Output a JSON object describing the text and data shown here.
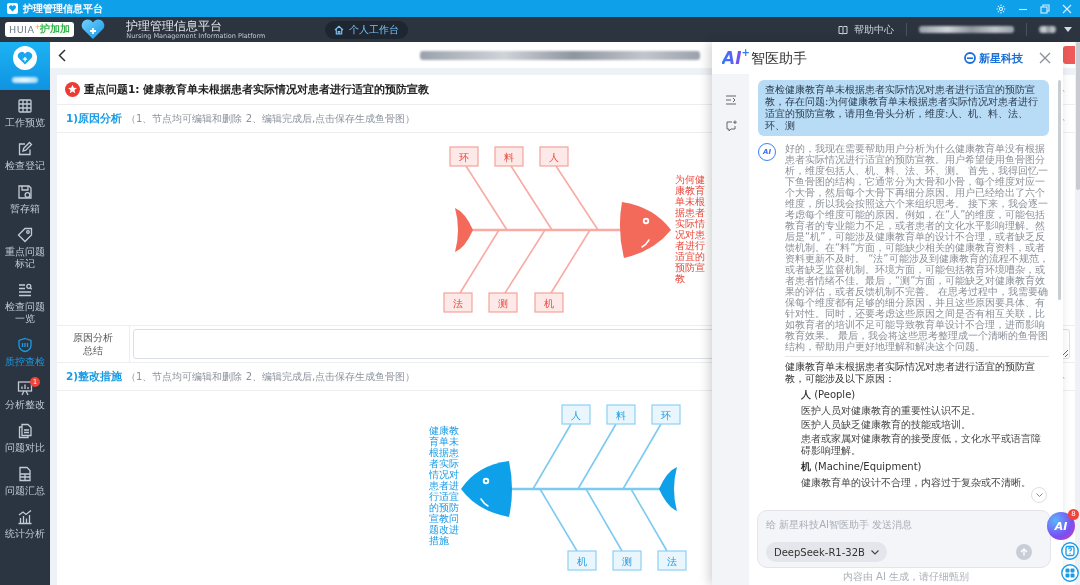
{
  "title_bar": {
    "title": "护理管理信息平台"
  },
  "header": {
    "logo": {
      "brand": "HUIA",
      "sup": "+",
      "name": "护加加"
    },
    "title": "护理管理信息平台",
    "subtitle": "Nursing Management Information Platform",
    "workspace_button": "个人工作台",
    "help": "帮助中心"
  },
  "sidebar": {
    "items": [
      {
        "label": "工作预览",
        "selected": false
      },
      {
        "label": "检查登记",
        "selected": false
      },
      {
        "label": "暂存箱",
        "selected": false
      },
      {
        "label": "重点问题标记",
        "selected": false
      },
      {
        "label": "检查问题一览",
        "selected": false
      },
      {
        "label": "质控查检",
        "selected": true
      },
      {
        "label": "分析整改",
        "selected": false,
        "badge": "1"
      },
      {
        "label": "问题对比",
        "selected": false
      },
      {
        "label": "问题汇总",
        "selected": false
      },
      {
        "label": "统计分析",
        "selected": false
      }
    ]
  },
  "problem": {
    "title": "重点问题1: 健康教育单未根据患者实际情况对患者进行适宜的预防宣教"
  },
  "sections": [
    {
      "kind": "cause",
      "title": "1)原因分析",
      "hint": "（1、节点均可编辑和删除 2、编辑完成后,点击保存生成鱼骨图）",
      "fishbone": {
        "effect": "为何健康教育单未根据患者实际情况对患者进行适宜的预防宣教",
        "top": [
          "环",
          "料",
          "人"
        ],
        "bottom": [
          "法",
          "测",
          "机"
        ]
      },
      "summary_label": "原因分析总结"
    },
    {
      "kind": "measure",
      "title": "2)整改措施",
      "hint": "（1、节点均可编辑和删除 2、编辑完成后,点击保存生成鱼骨图）",
      "fishbone": {
        "effect": "健康教育单未根据患者实际情况对患者进行适宜的预防宣教问题改进措施",
        "top": [
          "人",
          "料",
          "环"
        ],
        "bottom": [
          "机",
          "测",
          "法"
        ]
      }
    }
  ],
  "assistant": {
    "brand": {
      "mark": "AI",
      "sup": "+",
      "name": "智医助手"
    },
    "partner": "新星科技",
    "messages": [
      {
        "kind": "user",
        "text": "查检健康教育单未根据患者实际情况对患者进行适宜的预防宣教，存在问题:为何健康教育单未根据患者实际情况对患者进行适宜的预防宣教，请用鱼骨头分析，维度:人、机、料、法、环、测"
      },
      {
        "kind": "bot",
        "avatar": "AI",
        "thinking": "好的，我现在需要帮助用户分析为什么健康教育单没有根据患者实际情况进行适宜的预防宣教。用户希望使用鱼骨图分析，维度包括人、机、料、法、环、测。 首先，我得回忆一下鱼骨图的结构，它通常分为大骨和小骨，每个维度对应一个大骨，然后每个大骨下再细分原因。用户已经给出了六个维度，所以我会按照这六个来组织思考。 接下来，我会逐一考虑每个维度可能的原因。例如，在“人”的维度，可能包括教育者的专业能力不足，或者患者的文化水平影响理解。然后是“机”，可能涉及健康教育单的设计不合理，或者缺乏反馈机制。在“料”方面，可能缺少相关的健康教育资料，或者资料更新不及时。 “法”可能涉及到健康教育的流程不规范，或者缺乏监督机制。环境方面，可能包括教育环境嘈杂，或者患者情绪不佳。最后，“测”方面，可能缺乏对健康教育效果的评估，或者反馈机制不完善。 在思考过程中，我需要确保每个维度都有足够的细分原因，并且这些原因要具体、有针对性。同时，还要考虑这些原因之间是否有相互关联，比如教育者的培训不足可能导致教育单设计不合理，进而影响教育效果。 最后，我会将这些思考整理成一个清晰的鱼骨图结构，帮助用户更好地理解和解决这个问题。",
        "intro": "健康教育单未根据患者实际情况对患者进行适宜的预防宣教，可能涉及以下原因：",
        "groups": [
          {
            "heading": "**人** (People)",
            "items": [
              "医护人员对健康教育的重要性认识不足。",
              "医护人员缺乏健康教育的技能或培训。",
              "患者或家属对健康教育的接受度低，文化水平或语言障碍影响理解。"
            ]
          },
          {
            "heading": "**机** (Machine/Equipment)",
            "items": [
              "健康教育单的设计不合理，内容过于复杂或不清晰。"
            ]
          }
        ]
      }
    ],
    "input": {
      "placeholder": "给 新星科技AI智医助手 发送消息",
      "model": "DeepSeek-R1-32B"
    },
    "disclaimer": "内容由 AI 生成，请仔细甄别"
  },
  "float_buttons": {
    "ai": "AI",
    "badge": "8"
  }
}
